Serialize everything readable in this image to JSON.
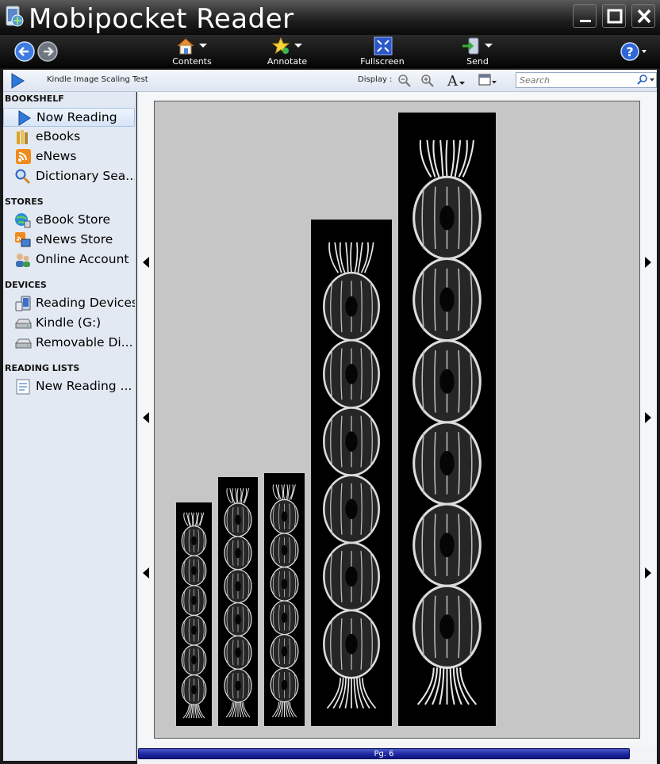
{
  "window": {
    "title": "Mobipocket Reader"
  },
  "toolbar": {
    "contents_label": "Contents",
    "annotate_label": "Annotate",
    "fullscreen_label": "Fullscreen",
    "send_label": "Send"
  },
  "addressbar": {
    "book_title": "Kindle Image Scaling Test",
    "display_label": "Display :",
    "search_placeholder": "Search"
  },
  "sidebar": {
    "sections": [
      {
        "title": "BOOKSHELF",
        "items": [
          {
            "label": "Now Reading",
            "icon": "play-icon",
            "selected": true
          },
          {
            "label": "eBooks",
            "icon": "books-icon"
          },
          {
            "label": "eNews",
            "icon": "rss-icon"
          },
          {
            "label": "Dictionary Sea...",
            "icon": "magnifier-icon"
          }
        ]
      },
      {
        "title": "STORES",
        "items": [
          {
            "label": "eBook Store",
            "icon": "globe-icon"
          },
          {
            "label": "eNews Store",
            "icon": "rss-store-icon"
          },
          {
            "label": "Online Account",
            "icon": "users-icon"
          }
        ]
      },
      {
        "title": "DEVICES",
        "items": [
          {
            "label": "Reading Devices",
            "icon": "devices-icon"
          },
          {
            "label": "Kindle (G:)",
            "icon": "drive-icon"
          },
          {
            "label": "Removable Di...",
            "icon": "removable-drive-icon"
          }
        ]
      },
      {
        "title": "READING LISTS",
        "items": [
          {
            "label": "New Reading ...",
            "icon": "list-icon"
          }
        ]
      }
    ]
  },
  "status": {
    "page_label": "Pg. 6"
  },
  "colors": {
    "accent": "#1f2ca8",
    "sidebar_bg": "#e3e9f2",
    "page_bg": "#c6c6c6"
  }
}
